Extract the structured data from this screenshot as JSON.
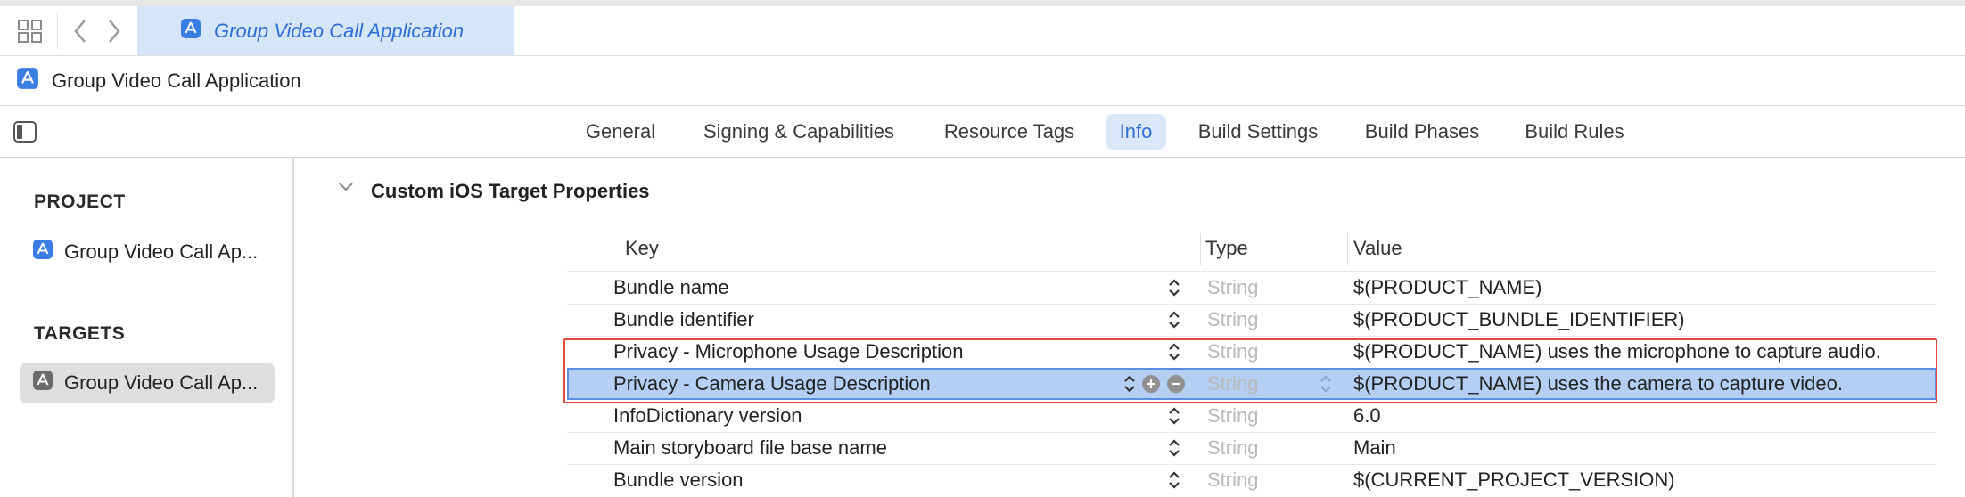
{
  "tabbar": {
    "editor_tab_title": "Group Video Call Application",
    "icons": [
      "grid-icon",
      "back-chevron-icon",
      "forward-chevron-icon",
      "app-icon"
    ]
  },
  "header": {
    "title": "Group Video Call Application"
  },
  "tabs": [
    {
      "label": "General",
      "active": false
    },
    {
      "label": "Signing & Capabilities",
      "active": false
    },
    {
      "label": "Resource Tags",
      "active": false
    },
    {
      "label": "Info",
      "active": true
    },
    {
      "label": "Build Settings",
      "active": false
    },
    {
      "label": "Build Phases",
      "active": false
    },
    {
      "label": "Build Rules",
      "active": false
    }
  ],
  "sidebar": {
    "project_title": "PROJECT",
    "project_item": "Group Video Call Ap...",
    "targets_title": "TARGETS",
    "target_item": "Group Video Call Ap..."
  },
  "content": {
    "section_title": "Custom iOS Target Properties",
    "columns": {
      "key": "Key",
      "type": "Type",
      "value": "Value"
    },
    "rows": [
      {
        "key": "Bundle name",
        "type": "String",
        "value": "$(PRODUCT_NAME)"
      },
      {
        "key": "Bundle identifier",
        "type": "String",
        "value": "$(PRODUCT_BUNDLE_IDENTIFIER)"
      },
      {
        "key": "Privacy - Microphone Usage Description",
        "type": "String",
        "value": "$(PRODUCT_NAME) uses the microphone to capture audio."
      },
      {
        "key": "Privacy - Camera Usage Description",
        "type": "String",
        "value": "$(PRODUCT_NAME) uses the camera to capture video.",
        "selected": true
      },
      {
        "key": "InfoDictionary version",
        "type": "String",
        "value": "6.0"
      },
      {
        "key": "Main storyboard file base name",
        "type": "String",
        "value": "Main"
      },
      {
        "key": "Bundle version",
        "type": "String",
        "value": "$(CURRENT_PROJECT_VERSION)"
      }
    ]
  },
  "colors": {
    "accent": "#2f6fd6",
    "selected_row": "#b5cff4",
    "highlight_box": "#e04a3a"
  }
}
